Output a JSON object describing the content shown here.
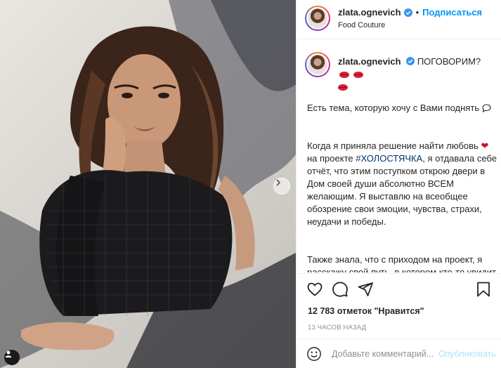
{
  "post": {
    "username": "zlata.ognevich",
    "verified": true,
    "follow_label": "Подписаться",
    "separator": "•",
    "location": "Food Couture"
  },
  "caption": {
    "username": "zlata.ognevich",
    "headline": "ПОГОВОРИМ?",
    "p1": "Есть тема, которую хочу с Вами поднять",
    "p2_a": "Когда я приняла решение найти любовь",
    "p2_b": "на проекте",
    "p2_hashtag": "#ХОЛОСТЯЧКА",
    "p2_c": ", я отдавала себе отчёт, что этим поступком открою двери в Дом своей души абсолютно ВСЕМ желающим. Я выставлю на всеобщее обозрение свои эмоции, чувства, страхи, неудачи и победы.",
    "p3": "Также знала, что с приходом на проект, я расскажу свой путь, в котором кто-то увидит повод для хейта, а кто-то- повод для мотивации"
  },
  "stats": {
    "likes": "12 783 отметок \"Нравится\"",
    "time_ago": "13 ЧАСОВ НАЗАД"
  },
  "comment": {
    "placeholder": "Добавьте комментарий...",
    "publish_label": "Опубликовать"
  },
  "icons": {
    "like": "heart-outline-icon",
    "comment": "speech-bubble-icon",
    "share": "paper-plane-icon",
    "save": "bookmark-icon",
    "emoji": "smiley-icon",
    "next": "chevron-right-icon",
    "tag": "user-tag-icon"
  },
  "colors": {
    "link_blue": "#0095f6",
    "hashtag": "#00376b",
    "muted": "#8e8e8e",
    "publish_disabled": "#b2dffc",
    "border": "#efefef"
  }
}
